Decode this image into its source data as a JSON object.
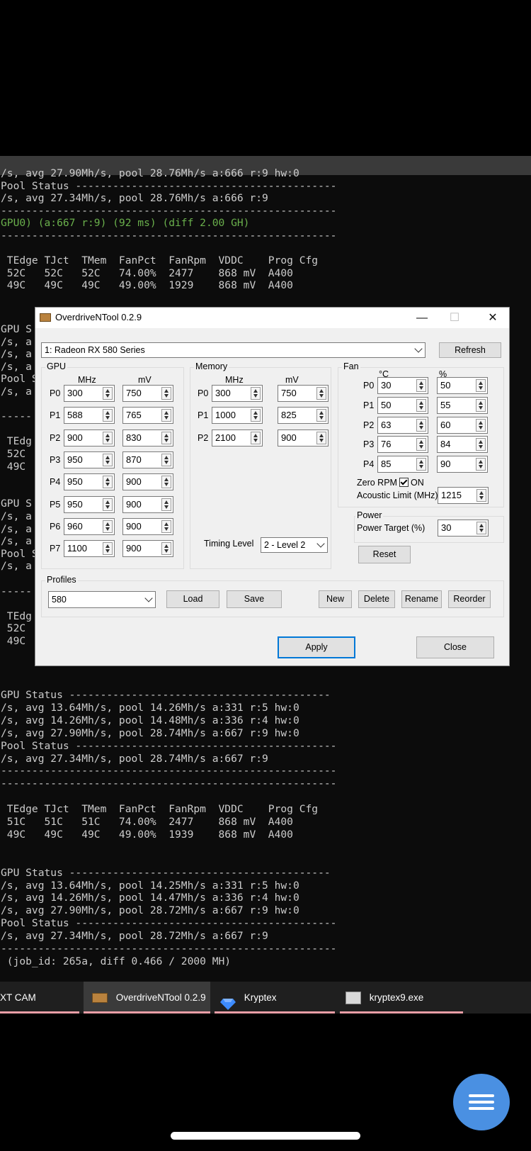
{
  "terminal": {
    "lines_top": [
      "/s, avg 27.90Mh/s, pool 28.76Mh/s a:666 r:9 hw:0",
      "Pool Status ------------------------------------------",
      "/s, avg 27.34Mh/s, pool 28.76Mh/s a:666 r:9",
      "------------------------------------------------------",
      "GPU0) (a:667 r:9) (92 ms) (diff 2.00 GH)",
      "------------------------------------------------------",
      "",
      " TEdge TJct  TMem  FanPct  FanRpm  VDDC    Prog Cfg",
      " 52C   52C   52C   74.00%  2477    868 mV  A400",
      " 49C   49C   49C   49.00%  1929    868 mV  A400"
    ],
    "lines_left": [
      "GPU S",
      "/s, a",
      "/s, a",
      "/s, a",
      "Pool S",
      "/s, a",
      "",
      "-----",
      "",
      " TEdg",
      " 52C",
      " 49C",
      "",
      "",
      "GPU S",
      "/s, a",
      "/s, a",
      "/s, a",
      "Pool S",
      "/s, a",
      "",
      "-----",
      "",
      " TEdg",
      " 52C",
      " 49C"
    ],
    "lines_bottom": [
      "GPU Status ------------------------------------------",
      "/s, avg 13.64Mh/s, pool 14.26Mh/s a:331 r:5 hw:0",
      "/s, avg 14.26Mh/s, pool 14.48Mh/s a:336 r:4 hw:0",
      "/s, avg 27.90Mh/s, pool 28.74Mh/s a:667 r:9 hw:0",
      "Pool Status ------------------------------------------",
      "/s, avg 27.34Mh/s, pool 28.74Mh/s a:667 r:9",
      "------------------------------------------------------",
      "------------------------------------------------------",
      "",
      " TEdge TJct  TMem  FanPct  FanRpm  VDDC    Prog Cfg",
      " 51C   51C   51C   74.00%  2477    868 mV  A400",
      " 49C   49C   49C   49.00%  1939    868 mV  A400",
      "",
      "",
      "GPU Status ------------------------------------------",
      "/s, avg 13.64Mh/s, pool 14.25Mh/s a:331 r:5 hw:0",
      "/s, avg 14.26Mh/s, pool 14.47Mh/s a:336 r:4 hw:0",
      "/s, avg 27.90Mh/s, pool 28.72Mh/s a:667 r:9 hw:0",
      "Pool Status ------------------------------------------",
      "/s, avg 27.34Mh/s, pool 28.72Mh/s a:667 r:9",
      "------------------------------------------------------",
      " (job_id: 265a, diff 0.466 / 2000 MH)"
    ]
  },
  "dialog": {
    "title": "OverdriveNTool 0.2.9",
    "minimize": "—",
    "maximize": "☐",
    "close": "✕",
    "gpu_select": "1: Radeon RX 580 Series",
    "refresh": "Refresh",
    "gpu": {
      "label": "GPU",
      "col_mhz": "MHz",
      "col_mv": "mV",
      "states": [
        {
          "name": "P0",
          "mhz": "300",
          "mv": "750"
        },
        {
          "name": "P1",
          "mhz": "588",
          "mv": "765"
        },
        {
          "name": "P2",
          "mhz": "900",
          "mv": "830"
        },
        {
          "name": "P3",
          "mhz": "950",
          "mv": "870"
        },
        {
          "name": "P4",
          "mhz": "950",
          "mv": "900"
        },
        {
          "name": "P5",
          "mhz": "950",
          "mv": "900"
        },
        {
          "name": "P6",
          "mhz": "960",
          "mv": "900"
        },
        {
          "name": "P7",
          "mhz": "1100",
          "mv": "900"
        }
      ]
    },
    "memory": {
      "label": "Memory",
      "col_mhz": "MHz",
      "col_mv": "mV",
      "states": [
        {
          "name": "P0",
          "mhz": "300",
          "mv": "750"
        },
        {
          "name": "P1",
          "mhz": "1000",
          "mv": "825"
        },
        {
          "name": "P2",
          "mhz": "2100",
          "mv": "900"
        }
      ],
      "timing_label": "Timing Level",
      "timing_value": "2 - Level 2"
    },
    "fan": {
      "label": "Fan",
      "col_c": "°C",
      "col_pct": "%",
      "states": [
        {
          "name": "P0",
          "temp": "30",
          "pct": "50"
        },
        {
          "name": "P1",
          "temp": "50",
          "pct": "55"
        },
        {
          "name": "P2",
          "temp": "63",
          "pct": "60"
        },
        {
          "name": "P3",
          "temp": "76",
          "pct": "84"
        },
        {
          "name": "P4",
          "temp": "85",
          "pct": "90"
        }
      ],
      "zero_rpm_label": "Zero RPM",
      "zero_rpm_on": "ON",
      "acoustic_label": "Acoustic Limit (MHz)",
      "acoustic_value": "1215"
    },
    "power": {
      "label": "Power",
      "target_label": "Power Target (%)",
      "target_value": "30"
    },
    "reset": "Reset",
    "profiles": {
      "label": "Profiles",
      "selected": "580",
      "load": "Load",
      "save": "Save",
      "new": "New",
      "delete": "Delete",
      "rename": "Rename",
      "reorder": "Reorder"
    },
    "apply": "Apply",
    "close_btn": "Close"
  },
  "taskbar": {
    "items": [
      {
        "label": "XT CAM"
      },
      {
        "label": "OverdriveNTool 0.2.9"
      },
      {
        "label": "Kryptex"
      },
      {
        "label": "kryptex9.exe"
      }
    ]
  },
  "colors": {
    "accent": "#0078d7",
    "fab": "#4a90e2",
    "taskbar_underline": "#e99ea6",
    "terminal_green": "#6ab04c"
  }
}
